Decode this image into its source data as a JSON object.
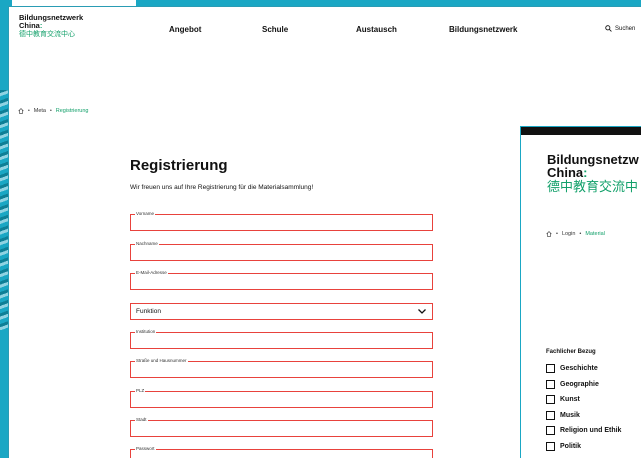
{
  "site": {
    "logo_line1": "Bildungsnetzwerk",
    "logo_line2": "China",
    "logo_line3": "德中教育交流中心"
  },
  "nav": {
    "items": [
      "Angebot",
      "Schule",
      "Austausch",
      "Bildungsnetzwerk"
    ],
    "search_label": "Suchen"
  },
  "breadcrumb": {
    "items": [
      "Meta",
      "Registrierung"
    ]
  },
  "form": {
    "title": "Registrierung",
    "intro": "Wir freuen uns auf Ihre Registrierung für die Materialsammlung!",
    "fields": [
      {
        "label": "Vorname",
        "value": ""
      },
      {
        "label": "Nachname",
        "value": ""
      },
      {
        "label": "E-Mail-Adresse",
        "value": ""
      },
      {
        "label": "Institution",
        "value": ""
      },
      {
        "label": "Straße und Hausnummer",
        "value": ""
      },
      {
        "label": "PLZ",
        "value": ""
      },
      {
        "label": "Stadt",
        "value": ""
      },
      {
        "label": "Passwort",
        "value": ""
      }
    ],
    "function_select": {
      "selected": "Funktion"
    }
  },
  "overlay_page": {
    "logo_line1": "Bildungsnetzw",
    "logo_line2": "China",
    "logo_line3": "德中教育交流中",
    "breadcrumb": [
      "Login",
      "Material"
    ],
    "filter_heading": "Fachlicher Bezug",
    "filter_items": [
      "Geschichte",
      "Geographie",
      "Kunst",
      "Musik",
      "Religion und Ethik",
      "Politik"
    ]
  },
  "colors": {
    "accent_green": "#12a06a",
    "field_border_red": "#e8423c",
    "teal": "#1aa7c4"
  }
}
